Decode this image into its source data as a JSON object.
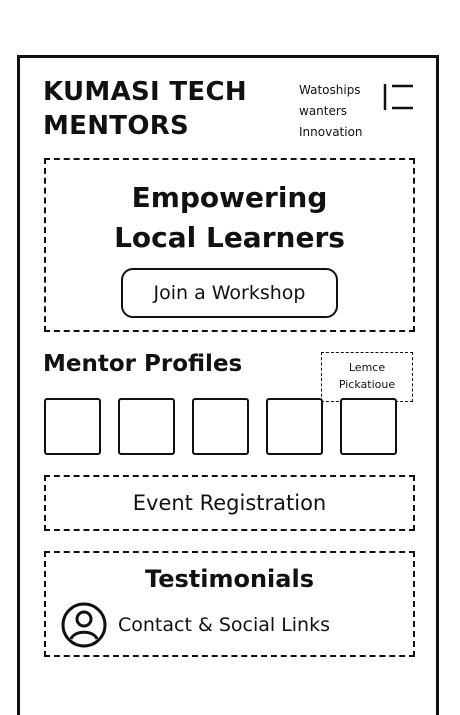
{
  "brand": {
    "line1": "KUMASI TECH",
    "line2": "MENTORS"
  },
  "nav": {
    "items": [
      "Watoships",
      "wanters",
      "Innovation"
    ]
  },
  "hero": {
    "line1": "Empowering",
    "line2": "Local Learners",
    "button_label": "Join a Workshop"
  },
  "mentors": {
    "title": "Mentor Profiles",
    "note_line1": "Lemce",
    "note_line2": "Pickatioue",
    "cards": [
      {
        "id": 1
      },
      {
        "id": 2
      },
      {
        "id": 3
      },
      {
        "id": 4
      },
      {
        "id": 5
      }
    ]
  },
  "event": {
    "label": "Event Registration"
  },
  "testimonials": {
    "title": "Testimonials",
    "contact_label": "Contact & Social Links"
  },
  "icons": {
    "menu": "hamburger-menu-icon",
    "contact": "user-circle-icon"
  }
}
